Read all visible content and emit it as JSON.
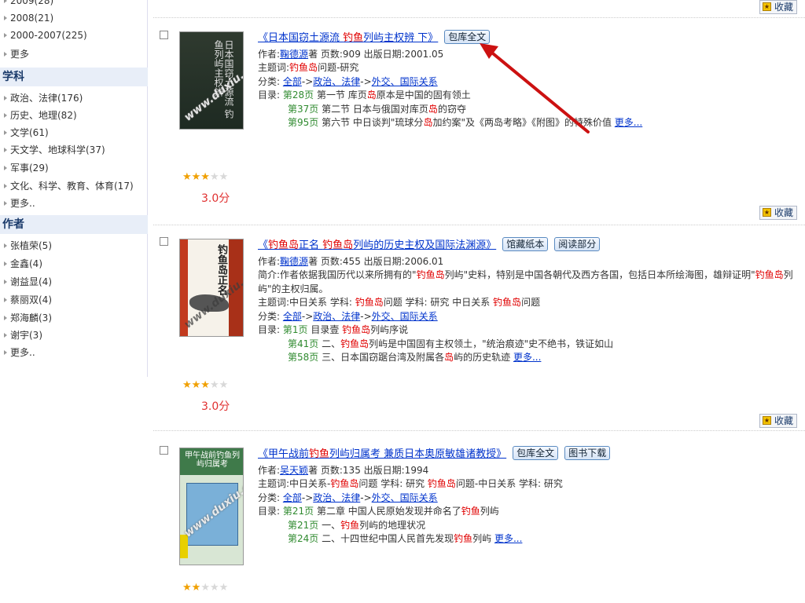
{
  "sidebar": {
    "year_items": [
      {
        "label": "2009(28)"
      },
      {
        "label": "2008(21)"
      },
      {
        "label": "2000-2007(225)"
      },
      {
        "label": "更多"
      }
    ],
    "subject_heading": "学科",
    "subject_items": [
      {
        "label": "政治、法律(176)"
      },
      {
        "label": "历史、地理(82)"
      },
      {
        "label": "文学(61)"
      },
      {
        "label": "天文学、地球科学(37)"
      },
      {
        "label": "军事(29)"
      },
      {
        "label": "文化、科学、教育、体育(17)"
      },
      {
        "label": "更多.."
      }
    ],
    "author_heading": "作者",
    "author_items": [
      {
        "label": "张植荣(5)"
      },
      {
        "label": "金鑫(4)"
      },
      {
        "label": "谢益显(4)"
      },
      {
        "label": "蔡丽双(4)"
      },
      {
        "label": "郑海麟(3)"
      },
      {
        "label": "谢宇(3)"
      },
      {
        "label": "更多.."
      }
    ]
  },
  "fav_label": "收藏",
  "results": [
    {
      "title_pre": "《日本国窃土源流 ",
      "title_hl": "钓鱼",
      "title_post": "列屿主权辨 下》",
      "buttons": [
        "包库全文"
      ],
      "author_prefix": "作者:",
      "author": "鞠德源",
      "author_suffix": "著  页数:909  出版日期:2001.05",
      "keywords_prefix": "主题词:",
      "keywords_hl": "钓鱼岛",
      "keywords_post": "问题-研究",
      "category_prefix": " 分类: ",
      "cat1": "全部",
      "cat2": "政治、法律",
      "cat3": "外交、国际关系",
      "toc_prefix": "目录: ",
      "toc": [
        {
          "page": "第28页",
          "pre": " 第一节 库页",
          "hl": "岛",
          "post": "原本是中国的固有领土"
        },
        {
          "page": "第37页",
          "pre": " 第二节 日本与俄国对库页",
          "hl": "岛",
          "post": "的窃夺"
        },
        {
          "page": "第95页",
          "pre": " 第六节 中日谈判\"琉球分",
          "hl": "岛",
          "post": "加约案\"及《两岛考略》《附图》的特殊价值 "
        }
      ],
      "more": "更多...",
      "rating": 3,
      "score": "3.0分",
      "cover_text": "日本国窃土源流 钓鱼列屿主权辨",
      "watermark": "www.duxiu.com"
    },
    {
      "title_pre": "《",
      "title_hl": "钓鱼岛",
      "title_mid": "正名 ",
      "title_hl2": "钓鱼岛",
      "title_post": "列屿的历史主权及国际法渊源》",
      "buttons": [
        "馆藏纸本",
        "阅读部分"
      ],
      "author_prefix": "作者:",
      "author": "鞠德源",
      "author_suffix": "著  页数:455  出版日期:2006.01",
      "abstract_pre": "简介:作者依据我国历代以来所拥有的\"",
      "abstract_hl": "钓鱼岛",
      "abstract_mid": "列屿\"史料，特别是中国各朝代及西方各国，包括日本所绘海图，雄辩证明\"",
      "abstract_hl2": "钓鱼岛",
      "abstract_post": "列屿\"的主权归属。",
      "keywords_prefix": "主题词:中日关系 学科: ",
      "keywords_hl": "钓鱼岛",
      "keywords_mid": "问题 学科: 研究 中日关系 ",
      "keywords_hl2": "钓鱼岛",
      "keywords_post": "问题",
      "category_prefix": " 分类: ",
      "cat1": "全部",
      "cat2": "政治、法律",
      "cat3": "外交、国际关系",
      "toc_prefix": "目录: ",
      "toc": [
        {
          "page": "第1页",
          "pre": " 目录壹 ",
          "hl": "钓鱼岛",
          "post": "列屿序说"
        },
        {
          "page": "第41页",
          "pre": " 二、",
          "hl": "钓鱼岛",
          "post": "列屿是中国固有主权领土，\"统治痕迹\"史不绝书，铁证如山"
        },
        {
          "page": "第58页",
          "pre": " 三、日本国窃踞台湾及附属各",
          "hl": "岛",
          "post": "屿的历史轨迹    "
        }
      ],
      "more": "更多...",
      "rating": 3,
      "score": "3.0分",
      "cover_text": "钓鱼岛正名",
      "watermark": "www.duxiu.com"
    },
    {
      "title_pre": "《甲午战前",
      "title_hl": "钓鱼",
      "title_post": "列屿归属考 兼质日本奥原敏雄诸教授》",
      "buttons": [
        "包库全文",
        "图书下载"
      ],
      "author_prefix": "作者:",
      "author": "吴天颖",
      "author_suffix": "著  页数:135  出版日期:1994",
      "keywords_prefix": "主题词:中日关系-",
      "keywords_hl": "钓鱼岛",
      "keywords_mid": "问题 学科: 研究 ",
      "keywords_hl2": "钓鱼岛",
      "keywords_post": "问题-中日关系 学科: 研究",
      "category_prefix": " 分类: ",
      "cat1": "全部",
      "cat2": "政治、法律",
      "cat3": "外交、国际关系",
      "toc_prefix": "目录: ",
      "toc": [
        {
          "page": "第21页",
          "pre": " 第二章 中国人民原始发现并命名了",
          "hl": "钓鱼",
          "post": "列屿"
        },
        {
          "page": "第21页",
          "pre": " 一、",
          "hl": "钓鱼",
          "post": "列屿的地理状况"
        },
        {
          "page": "第24页",
          "pre": " 二、十四世纪中国人民首先发现",
          "hl": "钓鱼",
          "post": "列屿 "
        }
      ],
      "more": "更多...",
      "rating": 2,
      "cover_text": "甲午战前钓鱼列屿归属考",
      "watermark": "www.duxiu.com"
    }
  ],
  "colors": {
    "highlight": "#e00000",
    "link": "#0033cc",
    "arrow": "#cc1111",
    "green": "#2f8a2f"
  }
}
